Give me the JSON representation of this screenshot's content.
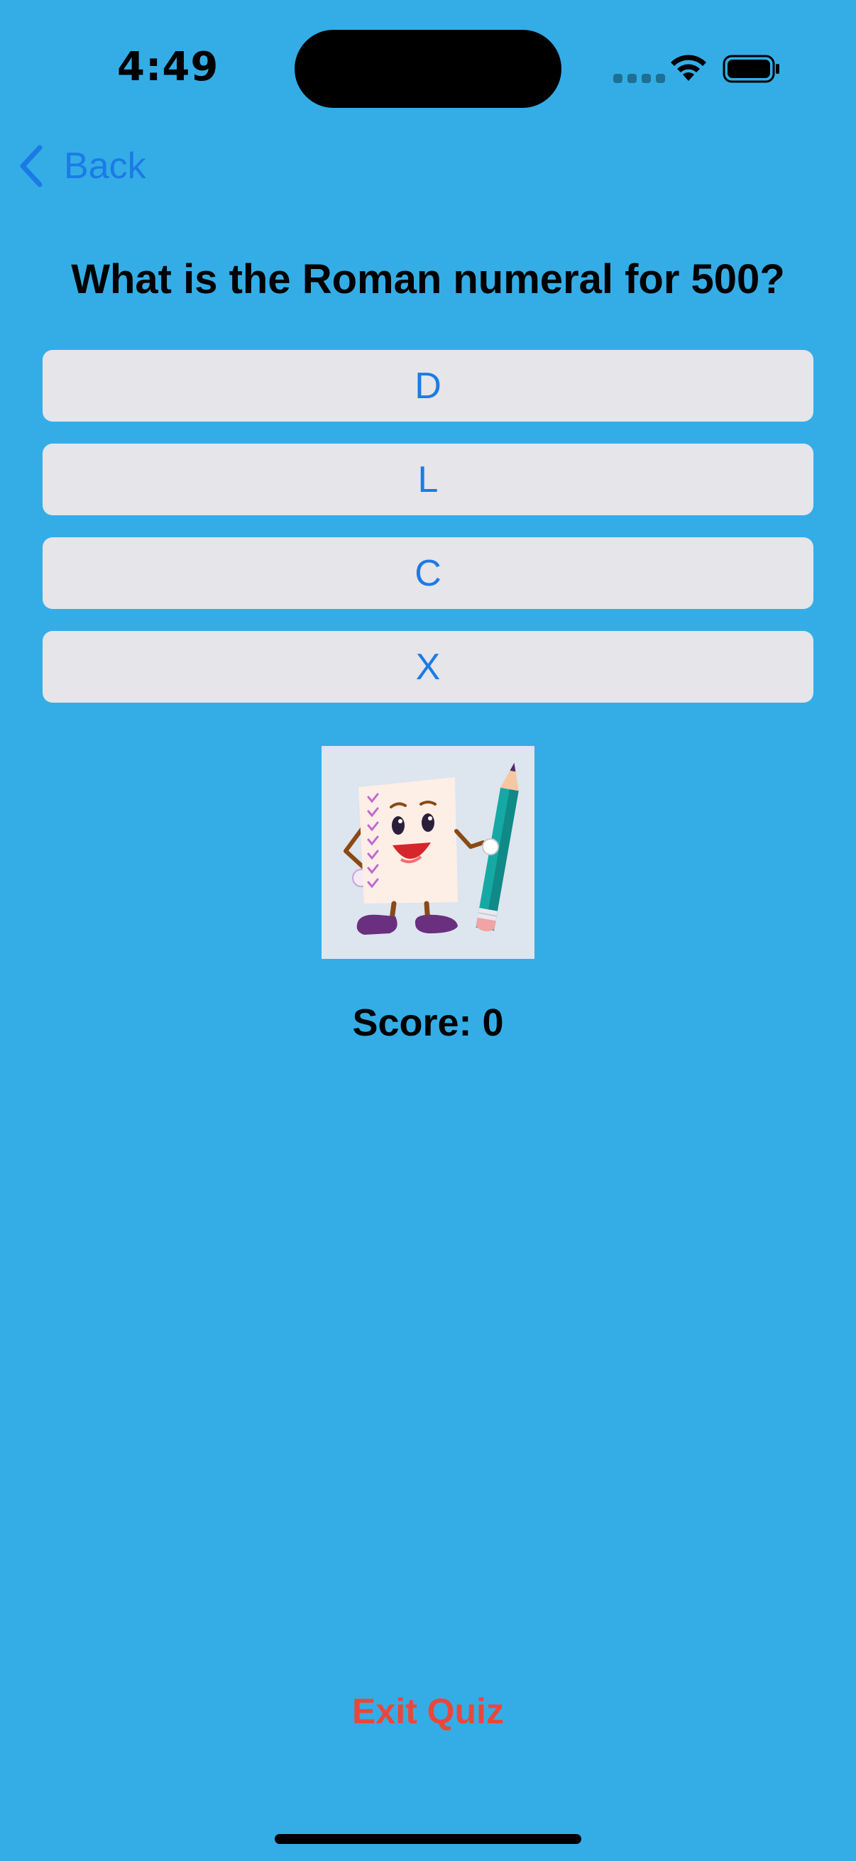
{
  "status_bar": {
    "time": "4:49"
  },
  "nav": {
    "back_label": "Back"
  },
  "quiz": {
    "question": "What is the Roman numeral for 500?",
    "answers": [
      "D",
      "L",
      "C",
      "X"
    ],
    "score_text": "Score: 0",
    "exit_label": "Exit Quiz"
  },
  "colors": {
    "background": "#34ade6",
    "accent": "#1b7be6",
    "button_background": "#e5e5ea",
    "destructive": "#e9473c"
  },
  "icons": {
    "back": "chevron-left-icon",
    "wifi": "wifi-icon",
    "battery": "battery-icon",
    "illustration": "quiz-mascot-illustration"
  }
}
